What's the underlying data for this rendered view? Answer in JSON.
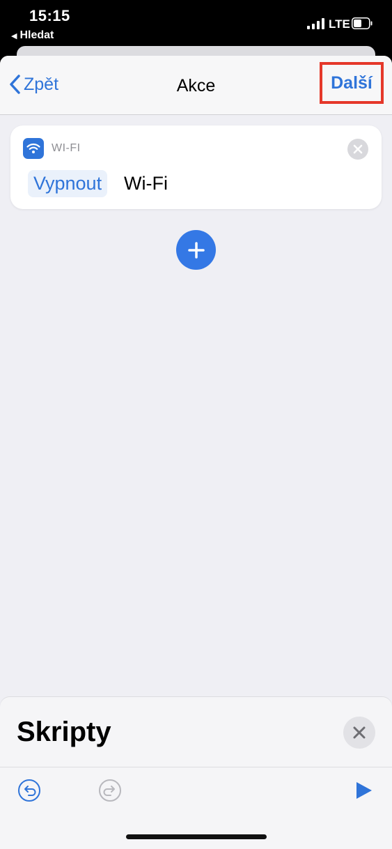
{
  "status_bar": {
    "time": "15:15",
    "back_app": "Hledat",
    "network": "LTE"
  },
  "nav": {
    "back_label": "Zpět",
    "title": "Akce",
    "next_label": "Další"
  },
  "action_card": {
    "category": "WI-FI",
    "param_value": "Vypnout",
    "text": "Wi-Fi"
  },
  "bottom_panel": {
    "title": "Skripty"
  },
  "colors": {
    "accent": "#2f74d9",
    "highlight_box": "#e5382a",
    "background": "#efeff4"
  },
  "icons": [
    "wifi-icon",
    "close-icon",
    "plus-icon",
    "undo-icon",
    "redo-icon",
    "play-icon",
    "chevron-left-icon"
  ]
}
